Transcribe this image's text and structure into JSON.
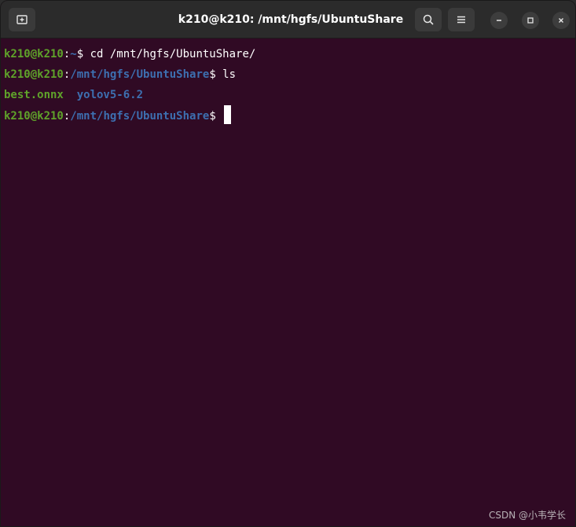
{
  "window": {
    "title": "k210@k210: /mnt/hgfs/UbuntuShare"
  },
  "icons": {
    "new_tab": "new-tab-icon",
    "search": "search-icon",
    "menu": "hamburger-menu-icon",
    "minimize": "minimize-icon",
    "maximize": "maximize-icon",
    "close": "close-icon"
  },
  "colors": {
    "background": "#300a24",
    "user": "#5fa32a",
    "path": "#3d6fb0",
    "text": "#ffffff"
  },
  "terminal": {
    "lines": [
      {
        "user": "k210@k210",
        "sep": ":",
        "path": "~",
        "prompt": "$ ",
        "command": "cd /mnt/hgfs/UbuntuShare/"
      },
      {
        "user": "k210@k210",
        "sep": ":",
        "path": "/mnt/hgfs/UbuntuShare",
        "prompt": "$ ",
        "command": "ls"
      },
      {
        "file": "best.onnx",
        "gap": "  ",
        "dir": "yolov5-6.2"
      },
      {
        "user": "k210@k210",
        "sep": ":",
        "path": "/mnt/hgfs/UbuntuShare",
        "prompt": "$ ",
        "command": ""
      }
    ]
  },
  "watermark": "CSDN @小韦学长"
}
